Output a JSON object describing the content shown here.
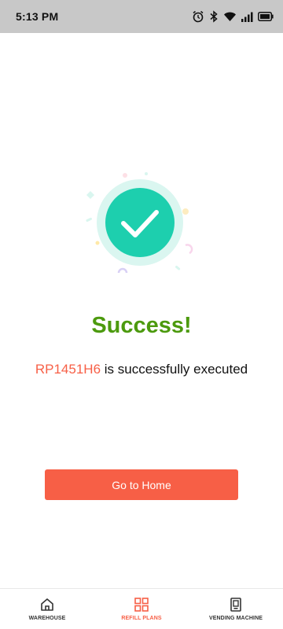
{
  "status_bar": {
    "time": "5:13 PM",
    "icons": [
      "alarm-icon",
      "bluetooth-icon",
      "wifi-icon",
      "signal-icon",
      "battery-icon"
    ]
  },
  "result": {
    "title": "Success!",
    "plan_code": "RP1451H6",
    "message_suffix": " is successfully executed"
  },
  "actions": {
    "home_label": "Go to Home"
  },
  "bottom_nav": {
    "items": [
      {
        "label": "WAREHOUSE",
        "icon": "home-icon",
        "active": false
      },
      {
        "label": "REFILL PLANS",
        "icon": "grid-icon",
        "active": true
      },
      {
        "label": "VENDING MACHINE",
        "icon": "vending-machine-icon",
        "active": false
      }
    ]
  },
  "colors": {
    "success_green": "#4c9a0e",
    "accent_orange": "#f75f46",
    "check_teal": "#1dcfae",
    "nav_inactive": "#333333"
  }
}
